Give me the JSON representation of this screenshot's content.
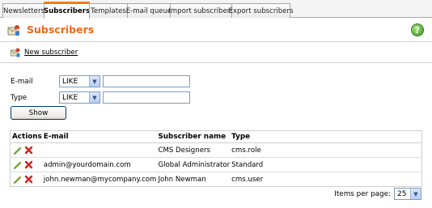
{
  "tabs": [
    {
      "label": "Newsletters",
      "active": false
    },
    {
      "label": "Subscribers",
      "active": true
    },
    {
      "label": "Templates",
      "active": false
    },
    {
      "label": "E-mail queue",
      "active": false
    },
    {
      "label": "Import subscribers",
      "active": false
    },
    {
      "label": "Export subscribers",
      "active": false
    }
  ],
  "header": {
    "title": "Subscribers",
    "icon": "subscribers-icon",
    "help_icon": "help-icon",
    "accent": "#ee6a1a"
  },
  "actions": {
    "new_subscriber": "New subscriber"
  },
  "filter": {
    "email_label": "E-mail",
    "email_operator": "LIKE",
    "email_value": "",
    "type_label": "Type",
    "type_operator": "LIKE",
    "type_value": "",
    "show_button": "Show"
  },
  "table": {
    "headers": [
      "Actions",
      "E-mail",
      "Subscriber name",
      "Type"
    ],
    "rows": [
      {
        "email": "",
        "name": "CMS Designers",
        "type": "cms.role"
      },
      {
        "email": "admin@yourdomain.com",
        "name": "Global Administrator",
        "type": "Standard"
      },
      {
        "email": "john.newman@mycompany.com",
        "name": "John Newman",
        "type": "cms.user"
      }
    ]
  },
  "paging": {
    "label": "Items per page:",
    "value": "25"
  }
}
